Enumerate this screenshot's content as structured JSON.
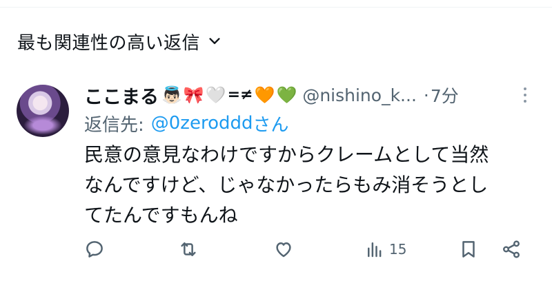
{
  "sort": {
    "label": "最も関連性の高い返信"
  },
  "post": {
    "name": "ここまる",
    "emojis": [
      "👼🏻",
      "🎀",
      "🤍",
      "=≠",
      "🧡",
      "💚"
    ],
    "handle": "@nishino_k...",
    "separator": "·",
    "time": "7分",
    "reply_prefix": "返信先:",
    "reply_mention": "@0zeroddd",
    "reply_suffix": "さん",
    "lines": [
      "民意の意見なわけですからクレームとして当然",
      "なんですけど、じゃなかったらもみ消そうとし",
      "てたんですもんね"
    ],
    "views": "15"
  },
  "colors": {
    "accent": "#1d9bf0",
    "muted": "#536471",
    "text": "#0f1419"
  }
}
